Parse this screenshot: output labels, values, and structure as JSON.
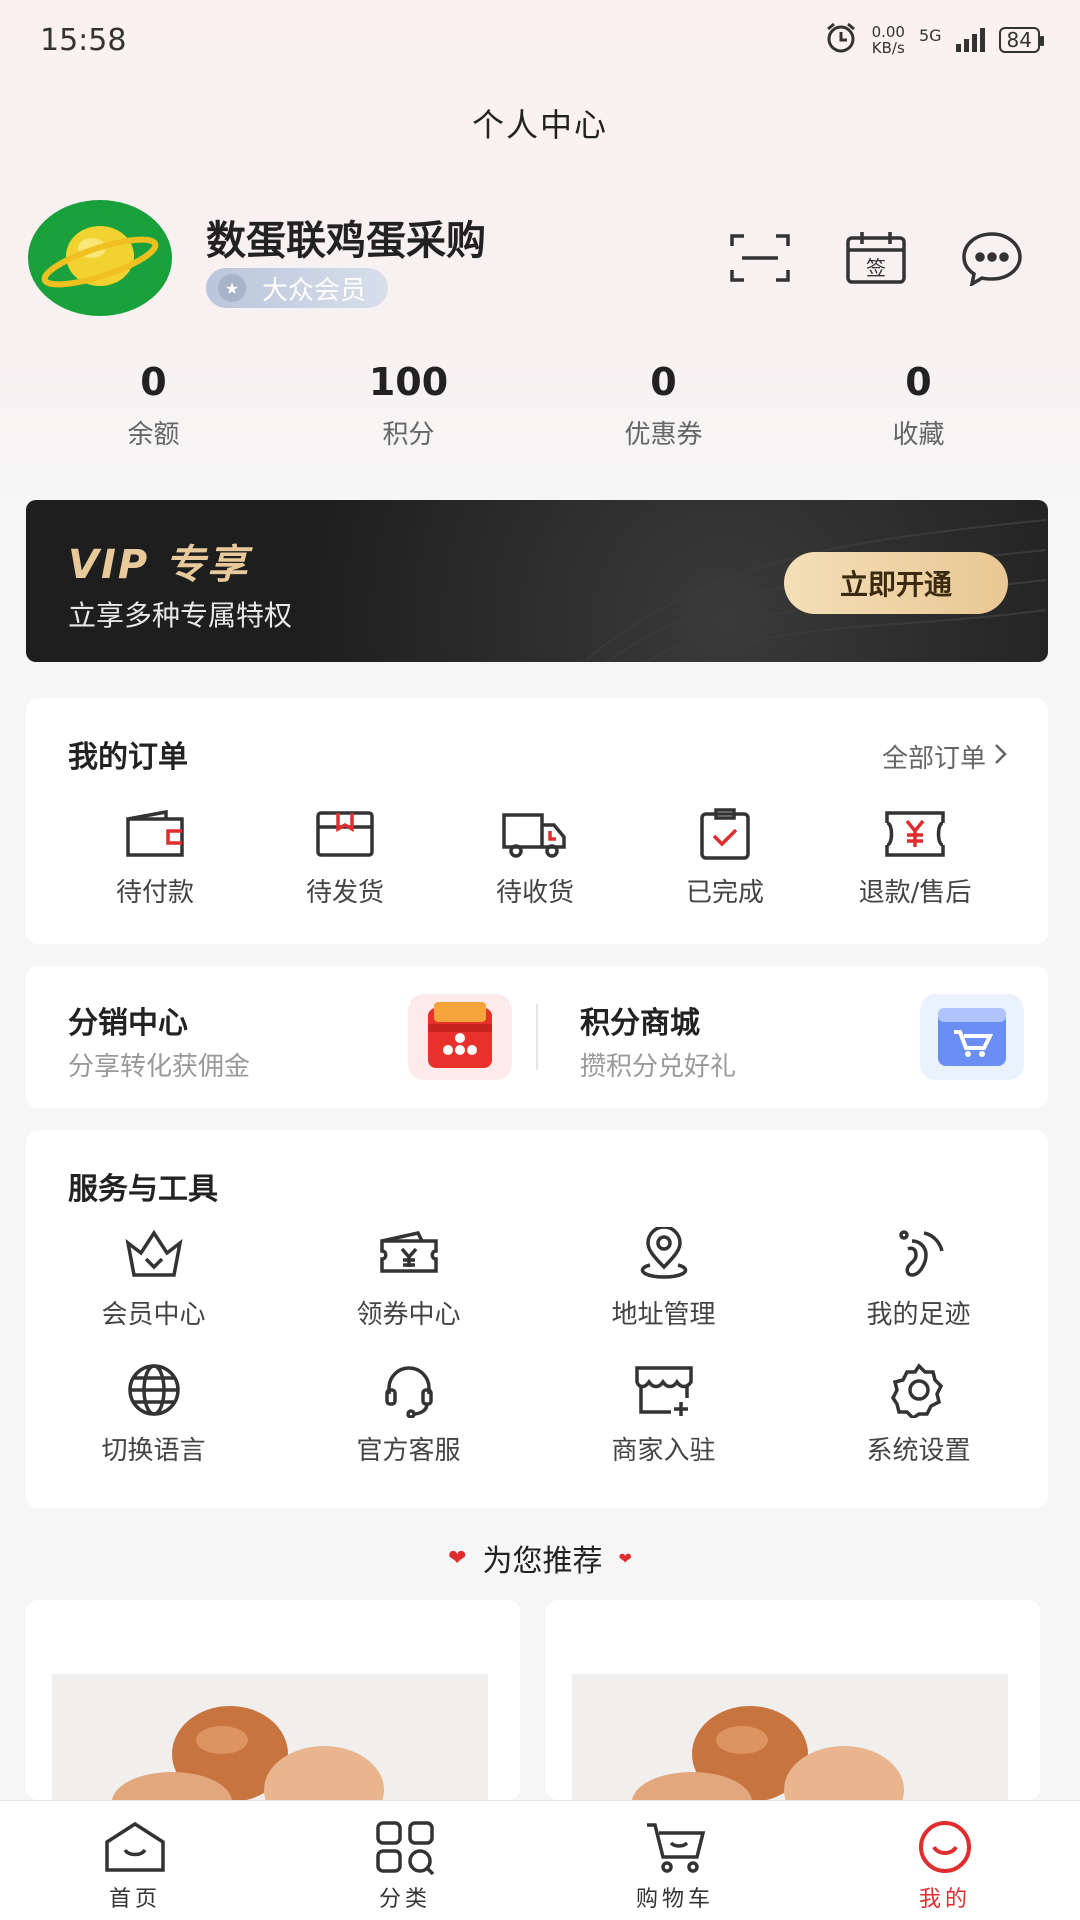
{
  "status_bar": {
    "time": "15:58",
    "net_speed_value": "0.00",
    "net_speed_unit": "KB/s",
    "network": "5G",
    "battery": "84"
  },
  "header": {
    "title": "个人中心"
  },
  "profile": {
    "name": "数蛋联鸡蛋采购",
    "member_level": "大众会员",
    "actions": [
      "scan-icon",
      "sign-in-icon",
      "message-icon"
    ],
    "sign_in_char": "签"
  },
  "stats": [
    {
      "value": "0",
      "label": "余额"
    },
    {
      "value": "100",
      "label": "积分"
    },
    {
      "value": "0",
      "label": "优惠券"
    },
    {
      "value": "0",
      "label": "收藏"
    }
  ],
  "vip": {
    "title": "VIP 专享",
    "subtitle": "立享多种专属特权",
    "button": "立即开通"
  },
  "orders": {
    "title": "我的订单",
    "all_label": "全部订单",
    "items": [
      {
        "label": "待付款",
        "icon": "wallet-icon"
      },
      {
        "label": "待发货",
        "icon": "box-icon"
      },
      {
        "label": "待收货",
        "icon": "truck-icon"
      },
      {
        "label": "已完成",
        "icon": "clipboard-check-icon"
      },
      {
        "label": "退款/售后",
        "icon": "refund-icon"
      }
    ]
  },
  "promo": {
    "left": {
      "title": "分销中心",
      "subtitle": "分享转化获佣金"
    },
    "right": {
      "title": "积分商城",
      "subtitle": "攒积分兑好礼"
    }
  },
  "tools": {
    "title": "服务与工具",
    "items": [
      {
        "label": "会员中心",
        "icon": "crown-icon"
      },
      {
        "label": "领券中心",
        "icon": "coupon-icon"
      },
      {
        "label": "地址管理",
        "icon": "location-icon"
      },
      {
        "label": "我的足迹",
        "icon": "footprint-icon"
      },
      {
        "label": "切换语言",
        "icon": "globe-icon"
      },
      {
        "label": "官方客服",
        "icon": "headset-icon"
      },
      {
        "label": "商家入驻",
        "icon": "store-icon"
      },
      {
        "label": "系统设置",
        "icon": "gear-icon"
      }
    ]
  },
  "recommend": {
    "title": "为您推荐"
  },
  "tabbar": [
    {
      "label": "首页",
      "icon": "home-icon",
      "active": false
    },
    {
      "label": "分类",
      "icon": "category-icon",
      "active": false
    },
    {
      "label": "购物车",
      "icon": "cart-icon",
      "active": false
    },
    {
      "label": "我的",
      "icon": "profile-icon",
      "active": true
    }
  ],
  "colors": {
    "accent": "#e02e2e",
    "vip_gold": "#e9c794",
    "vip_bg": "#1e1e1e"
  }
}
